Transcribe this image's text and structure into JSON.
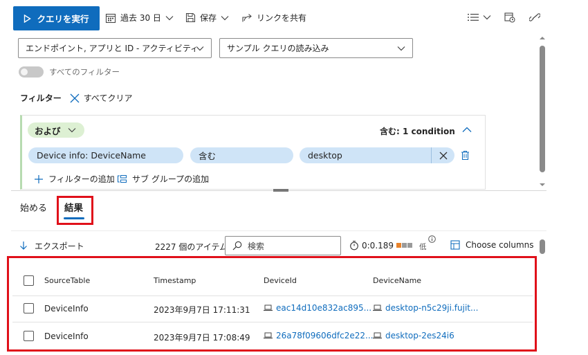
{
  "toolbar": {
    "run_label": "クエリを実行",
    "time_range": "過去 30 日",
    "save_label": "保存",
    "share_label": "リンクを共有"
  },
  "query": {
    "source_dropdown": "エンドポイント, アプリと ID - アクティビティ ログ,...",
    "sample_dropdown": "サンプル クエリの読み込み",
    "all_filters_toggle": "すべてのフィルター",
    "filters_label": "フィルター",
    "clear_all": "すべてクリア"
  },
  "filter_group": {
    "operator": "および",
    "summary": "含む: 1 condition",
    "condition": {
      "field_prefix": "Device info: ",
      "field_name": "DeviceName",
      "operator": "含む",
      "value": "desktop"
    },
    "add_filter": "フィルターの追加",
    "add_subgroup": "サブ グループの追加"
  },
  "tabs": [
    {
      "label": "始める",
      "active": false
    },
    {
      "label": "結果",
      "active": true
    }
  ],
  "results_bar": {
    "export": "エクスポート",
    "item_count": "2227 個のアイテム",
    "search_placeholder": "検索",
    "elapsed": "0:0.189",
    "level": "低",
    "choose_columns": "Choose columns"
  },
  "table": {
    "columns": [
      "SourceTable",
      "Timestamp",
      "DeviceId",
      "DeviceName"
    ],
    "rows": [
      {
        "source": "DeviceInfo",
        "timestamp": "2023年9月7日 17:11:31",
        "device_id": "eac14d10e832ac895...",
        "device_name": "desktop-n5c29ji.fujit..."
      },
      {
        "source": "DeviceInfo",
        "timestamp": "2023年9月7日 17:08:49",
        "device_id": "26a78f09606dfc2e22...",
        "device_name": "desktop-2es24i6"
      }
    ]
  },
  "colors": {
    "accent": "#0f6cbd",
    "highlight": "#e0101a",
    "pill": "#cfe4f7",
    "group_bg": "#ddf0d3"
  }
}
